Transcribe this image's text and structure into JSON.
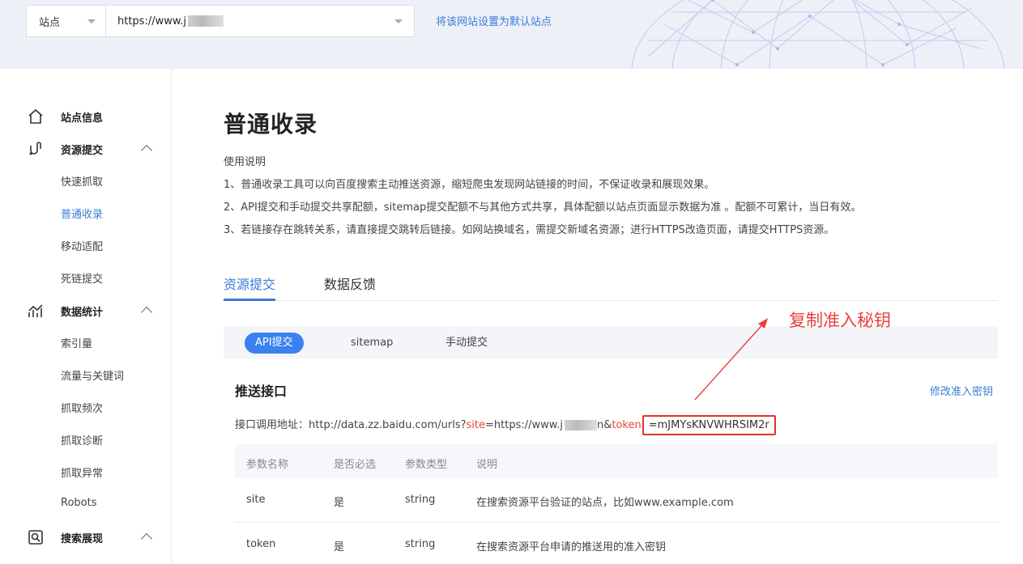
{
  "header": {
    "site_prefix": "站点",
    "site_url": "https://www.j",
    "set_default_link": "将该网站设置为默认站点"
  },
  "sidebar": {
    "groups": [
      {
        "label": "站点信息",
        "icon": "home-icon"
      },
      {
        "label": "资源提交",
        "icon": "submit-icon",
        "items": [
          "快速抓取",
          "普通收录",
          "移动适配",
          "死链提交"
        ]
      },
      {
        "label": "数据统计",
        "icon": "chart-icon",
        "items": [
          "索引量",
          "流量与关键词",
          "抓取频次",
          "抓取诊断",
          "抓取异常",
          "Robots"
        ]
      },
      {
        "label": "搜索展现",
        "icon": "search-display-icon"
      }
    ],
    "active_item": "普通收录"
  },
  "main": {
    "title": "普通收录",
    "desc_heading": "使用说明",
    "desc_lines": [
      "1、普通收录工具可以向百度搜索主动推送资源，缩短爬虫发现网站链接的时间，不保证收录和展现效果。",
      "2、API提交和手动提交共享配额，sitemap提交配额不与其他方式共享，具体配额以站点页面显示数据为准 。配额不可累计，当日有效。",
      "3、若链接存在跳转关系，请直接提交跳转后链接。如网站换域名，需提交新域名资源；进行HTTPS改造页面，请提交HTTPS资源。"
    ],
    "tabs": [
      "资源提交",
      "数据反馈"
    ],
    "subtabs": [
      "API提交",
      "sitemap",
      "手动提交"
    ],
    "annotation": "复制准入秘钥",
    "section_title": "推送接口",
    "edit_key_link": "修改准入密钥",
    "api": {
      "label": "接口调用地址：",
      "base": "http://data.zz.baidu.com/urls?",
      "site_key": "site",
      "site_value": "=https://www.j",
      "site_tail": "n&",
      "token_key": "token",
      "eq": "=",
      "token_value": "mJMYsKNVWHRSIM2r"
    },
    "param_table": {
      "headers": [
        "参数名称",
        "是否必选",
        "参数类型",
        "说明"
      ],
      "rows": [
        [
          "site",
          "是",
          "string",
          "在搜索资源平台验证的站点，比如www.example.com"
        ],
        [
          "token",
          "是",
          "string",
          "在搜索资源平台申请的推送用的准入密钥"
        ]
      ]
    }
  },
  "colors": {
    "accent": "#3a7bd5",
    "annotation": "#e8413a",
    "pill": "#3b82f0"
  }
}
